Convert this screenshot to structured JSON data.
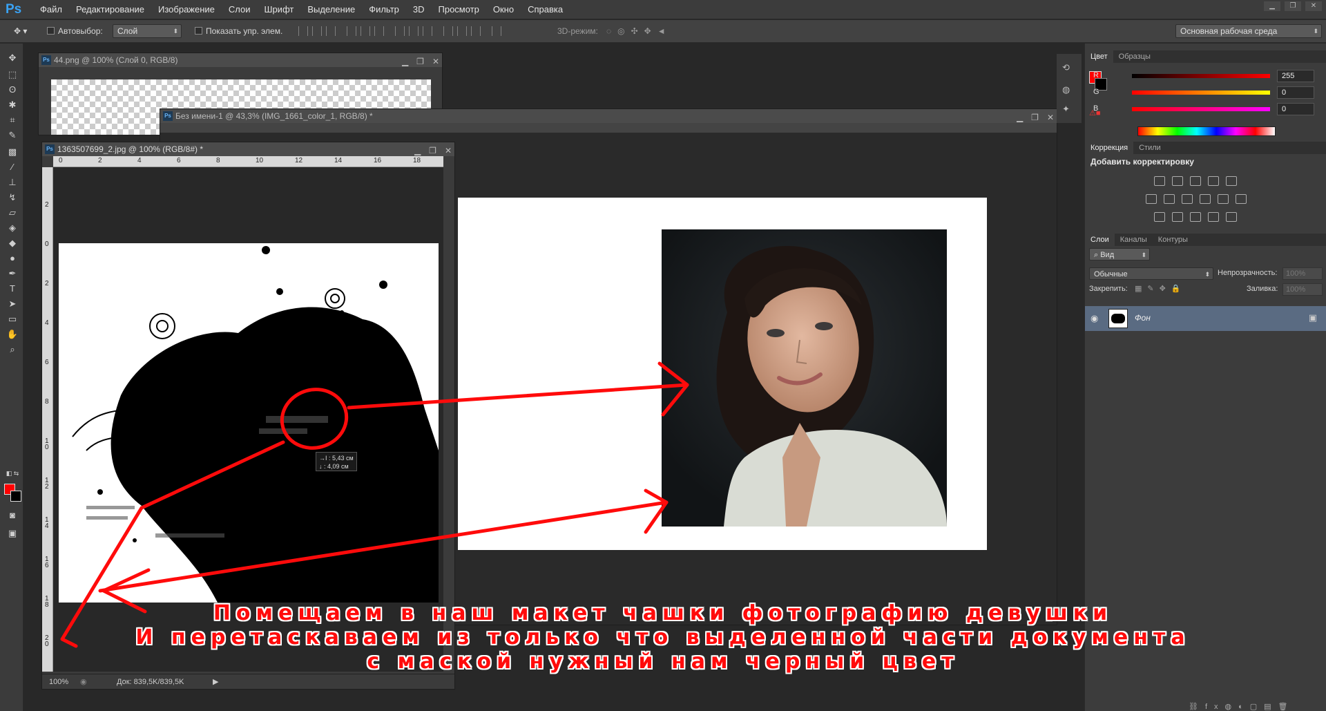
{
  "app": {
    "logo": "Ps"
  },
  "menu": [
    "Файл",
    "Редактирование",
    "Изображение",
    "Слои",
    "Шрифт",
    "Выделение",
    "Фильтр",
    "3D",
    "Просмотр",
    "Окно",
    "Справка"
  ],
  "options": {
    "autoselect_label": "Автовыбор:",
    "autoselect_value": "Слой",
    "show_transform_label": "Показать упр. элем.",
    "mode3d_label": "3D-режим:",
    "workspace_value": "Основная рабочая среда"
  },
  "documents": {
    "doc1": {
      "title": "44.png @ 100% (Слой 0, RGB/8)"
    },
    "doc2": {
      "title": "Без имени-1 @ 43,3% (IMG_1661_color_1, RGB/8) *"
    },
    "doc3": {
      "title": "1363507699_2.jpg @ 100% (RGB/8#) *",
      "ruler_h": [
        "0",
        "2",
        "4",
        "6",
        "8",
        "10",
        "12",
        "14",
        "16",
        "18"
      ],
      "ruler_v": [
        "2",
        "0",
        "2",
        "4",
        "6",
        "8",
        "1 0",
        "1 2",
        "1 4",
        "1 6",
        "1 8",
        "2 0"
      ],
      "zoom": "100%",
      "doc_size": "Док: 839,5K/839,5K",
      "tooltip_w": "→I : 5,43 см",
      "tooltip_h": "↓ : 4,09 см"
    }
  },
  "color_panel": {
    "tabs": [
      "Цвет",
      "Образцы"
    ],
    "r_label": "R",
    "r_value": "255",
    "g_label": "G",
    "g_value": "0",
    "b_label": "B",
    "b_value": "0",
    "fg": "#ff0000",
    "bg": "#000000"
  },
  "adjust_panel": {
    "tabs": [
      "Коррекция",
      "Стили"
    ],
    "heading": "Добавить корректировку"
  },
  "layers_panel": {
    "tabs": [
      "Слои",
      "Каналы",
      "Контуры"
    ],
    "filter_value": "Вид",
    "blend_value": "Обычные",
    "opacity_label": "Непрозрачность:",
    "opacity_value": "100%",
    "lock_label": "Закрепить:",
    "fill_label": "Заливка:",
    "fill_value": "100%",
    "layer_name": "Фон"
  },
  "annotation": {
    "line1": "Помещаем в наш макет чашки фотографию девушки",
    "line2": "И перетаскаваем из только что выделенной части документа",
    "line3": "с маской нужный нам черный цвет"
  }
}
